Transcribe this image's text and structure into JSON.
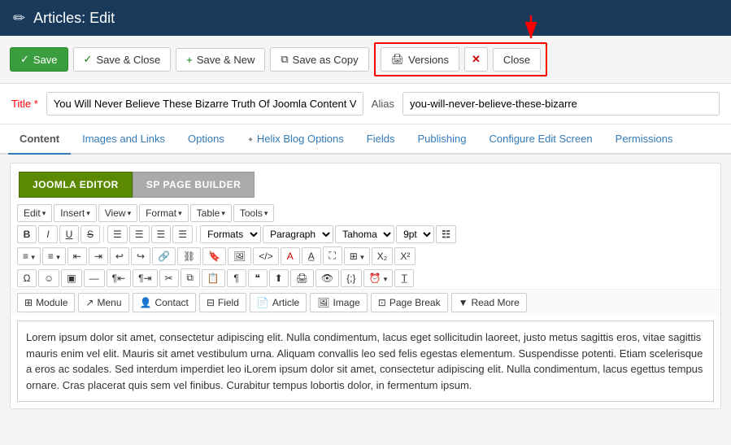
{
  "header": {
    "icon": "✏",
    "title": "Articles: Edit"
  },
  "toolbar": {
    "save_label": "Save",
    "save_close_label": "Save & Close",
    "save_new_label": "Save & New",
    "save_copy_label": "Save as Copy",
    "versions_label": "Versions",
    "close_label": "Close"
  },
  "title_field": {
    "label": "Title",
    "required": "*",
    "value": "You Will Never Believe These Bizarre Truth Of Joomla Content Ver:",
    "alias_label": "Alias",
    "alias_value": "you-will-never-believe-these-bizarre"
  },
  "tabs": [
    {
      "label": "Content",
      "active": true
    },
    {
      "label": "Images and Links",
      "active": false
    },
    {
      "label": "Options",
      "active": false
    },
    {
      "label": "Helix Blog Options",
      "active": false,
      "icon": "✦"
    },
    {
      "label": "Fields",
      "active": false
    },
    {
      "label": "Publishing",
      "active": false
    },
    {
      "label": "Configure Edit Screen",
      "active": false
    },
    {
      "label": "Permissions",
      "active": false
    }
  ],
  "editor": {
    "joomla_editor_label": "JOOMLA EDITOR",
    "sp_builder_label": "SP PAGE BUILDER",
    "menu_edit": "Edit",
    "menu_insert": "Insert",
    "menu_view": "View",
    "menu_format": "Format",
    "menu_table": "Table",
    "menu_tools": "Tools",
    "format_formats": "Formats",
    "format_paragraph": "Paragraph",
    "format_font": "Tahoma",
    "format_size": "9pt",
    "bottom_buttons": [
      "Module",
      "Menu",
      "Contact",
      "Field",
      "Article",
      "Image",
      "Page Break",
      "Read More"
    ],
    "content": "Lorem ipsum dolor sit amet, consectetur adipiscing elit. Nulla condimentum, lacus eget sollicitudin laoreet, justo metus sagittis eros, vitae sagittis mauris enim vel elit. Mauris sit amet vestibulum urna. Aliquam convallis leo sed felis egestas elementum. Suspendisse potenti. Etiam scelerisque a eros ac sodales. Sed interdum imperdiet leo iLorem ipsum dolor sit amet, consectetur adipiscing elit. Nulla condimentum, lacus egettus tempus ornare. Cras placerat quis sem vel finibus. Curabitur tempus lobortis dolor, in fermentum ipsum."
  },
  "icons": {
    "edit_pencil": "✏",
    "check": "✓",
    "plus": "+",
    "copy": "⧉",
    "printer": "🖨",
    "close_x": "✕",
    "bold": "B",
    "italic": "I",
    "underline": "U",
    "strike": "S",
    "align_left": "≡",
    "align_center": "≡",
    "align_right": "≡",
    "align_justify": "≡",
    "omega": "Ω",
    "smiley": "☺",
    "link": "🔗",
    "image_icon": "🖼",
    "code": "</>",
    "module_icon": "⊞",
    "menu_icon": "☰",
    "contact_icon": "👤",
    "field_icon": "⊟",
    "article_icon": "📄",
    "image_btn_icon": "🖼",
    "pagebreak_icon": "⊡",
    "readmore_icon": "▼"
  }
}
